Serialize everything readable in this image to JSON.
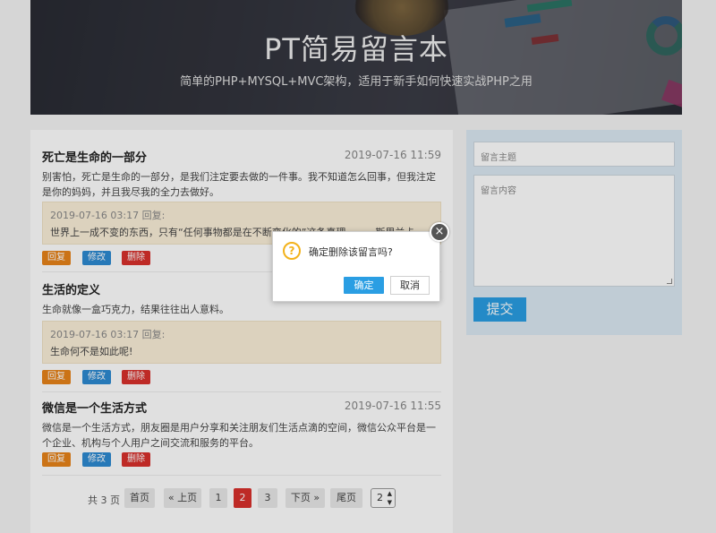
{
  "header": {
    "title": "PT简易留言本",
    "subtitle": "简单的PHP+MYSQL+MVC架构，适用于新手如何快速实战PHP之用"
  },
  "posts": [
    {
      "title": "死亡是生命的一部分",
      "time": "2019-07-16 11:59",
      "body": "别害怕，死亡是生命的一部分，是我们注定要去做的一件事。我不知道怎么回事，但我注定是你的妈妈，并且我尽我的全力去做好。",
      "reply_meta": "2019-07-16 03:17 回复:",
      "reply_text": "世界上一成不变的东西，只有“任何事物都是在不断变化的”这条真理。——斯里兰卡"
    },
    {
      "title": "生活的定义",
      "time": "",
      "body": "生命就像一盒巧克力，结果往往出人意料。",
      "reply_meta": "2019-07-16 03:17 回复:",
      "reply_text": "生命何不是如此呢!"
    },
    {
      "title": "微信是一个生活方式",
      "time": "2019-07-16 11:55",
      "body": "微信是一个生活方式，朋友圈是用户分享和关注朋友们生活点滴的空间，微信公众平台是一个企业、机构与个人用户之间交流和服务的平台。",
      "reply_meta": "",
      "reply_text": ""
    }
  ],
  "actions": {
    "reply": "回复",
    "edit": "修改",
    "delete": "删除"
  },
  "pagination": {
    "total": "共 3 页",
    "first": "首页",
    "prev": "« 上页",
    "pages": [
      "1",
      "2",
      "3"
    ],
    "current": "2",
    "next": "下页 »",
    "last": "尾页",
    "select_value": "2"
  },
  "form": {
    "subject_placeholder": "留言主题",
    "content_placeholder": "留言内容",
    "submit": "提交"
  },
  "dialog": {
    "message": "确定删除该留言吗?",
    "confirm": "确定",
    "cancel": "取消",
    "close_glyph": "×",
    "icon_glyph": "?"
  },
  "colors": {
    "accent_blue": "#2a9ee3",
    "reply_orange": "#e8831a",
    "edit_blue": "#2d8ad2",
    "delete_red": "#d9302c",
    "reply_box_bg": "#fbefd9",
    "form_panel_bg": "#dbe9f3",
    "warning_yellow": "#f3b21b"
  }
}
